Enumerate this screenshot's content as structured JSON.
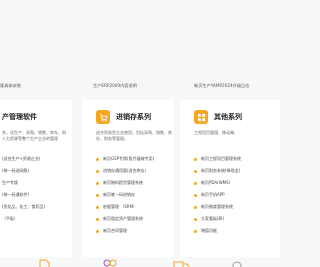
{
  "top_row": {
    "left_text": "版具体安装",
    "mid_text": "生产ERP2009内容说明",
    "right_text": "新页生产YAMP2024升级日志"
  },
  "cards": {
    "left": {
      "title": "产管理软件",
      "desc": "系，适生产、采购、销售、库存、财人力资源等整个生产企业的管理",
      "items": [
        "(适合生产+资源企业)",
        "(带一码送网版)",
        "生产专版",
        "(带一码通软件)",
        "(优化品、化工、食药品)",
        "（平板）"
      ]
    },
    "mid": {
      "title": "进销存系列",
      "desc": "适合贸易型企业使用，包括采购、销售、库存、财务等管理。",
      "items": [
        "新页GSP专版(医疗器械专用)",
        "进销存通用版(适合库存)",
        "新页物料提货管理系统",
        "新页唯一码进销存",
        "依据管理 （SRM）",
        "新页固定资产管理系统",
        "新页合同管理"
      ]
    },
    "right": {
      "title": "其他系列",
      "desc": "工程项目管理、移动端、",
      "items": [
        "新页工程项目管理系统",
        "新页财务系统(带现金)",
        "新页PDA(WMS)",
        "新页手机APP",
        "新页制度管理系统",
        "大家看板(BI)",
        "增值功能"
      ]
    }
  },
  "icons": {
    "mid_icon": "cart-icon",
    "right_icon": "grid-icon",
    "left_icon": "document-icon"
  },
  "colors": {
    "accent": "#f5a623",
    "background": "#f7f8fa",
    "card": "#ffffff"
  }
}
